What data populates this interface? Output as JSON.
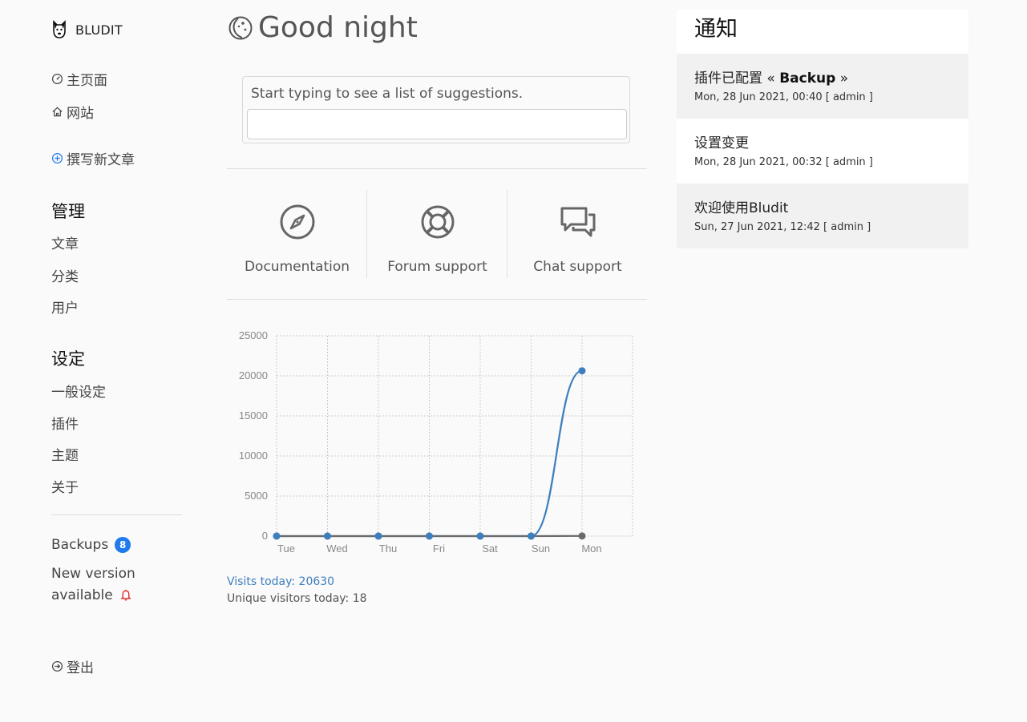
{
  "brand": {
    "name": "BLUDIT",
    "logo_icon": "dog-logo-icon"
  },
  "sidebar": {
    "top_links": [
      {
        "label": "主页面",
        "icon": "dashboard-icon"
      },
      {
        "label": "网站",
        "icon": "home-icon"
      }
    ],
    "new_content": {
      "label": "撰写新文章",
      "icon": "plus-circle-icon",
      "icon_color": "#1f7aec"
    },
    "manage": {
      "heading": "管理",
      "items": [
        {
          "label": "文章"
        },
        {
          "label": "分类"
        },
        {
          "label": "用户"
        }
      ]
    },
    "settings": {
      "heading": "设定",
      "items": [
        {
          "label": "一般设定"
        },
        {
          "label": "插件"
        },
        {
          "label": "主题"
        },
        {
          "label": "关于"
        }
      ]
    },
    "backups": {
      "label": "Backups",
      "count": "8"
    },
    "new_version": {
      "label": "New version available",
      "icon": "bell-icon",
      "icon_color": "#e02020"
    },
    "logout": {
      "label": "登出",
      "icon": "logout-icon"
    }
  },
  "main": {
    "greeting": {
      "text": "Good night",
      "icon": "moon-icon"
    },
    "search": {
      "hint": "Start typing to see a list of suggestions.",
      "value": ""
    },
    "support": [
      {
        "label": "Documentation",
        "icon": "compass-icon"
      },
      {
        "label": "Forum support",
        "icon": "life-ring-icon"
      },
      {
        "label": "Chat support",
        "icon": "chat-bubbles-icon"
      }
    ],
    "stats": {
      "visits_today": "Visits today: 20630",
      "unique_today": "Unique visitors today: 18"
    }
  },
  "chart_data": {
    "type": "line",
    "categories": [
      "Tue",
      "Wed",
      "Thu",
      "Fri",
      "Sat",
      "Sun",
      "Mon"
    ],
    "series": [
      {
        "values": [
          0,
          0,
          0,
          0,
          0,
          0,
          20630
        ],
        "color": "#3d7ebf"
      },
      {
        "values": [
          0,
          0,
          0,
          0,
          0,
          0,
          18
        ],
        "color": "#6b6b6b"
      }
    ],
    "yticks": [
      0,
      5000,
      10000,
      15000,
      20000,
      25000
    ],
    "ylim": [
      0,
      25000
    ],
    "grid": true
  },
  "notifications": {
    "title": "通知",
    "items": [
      {
        "prefix": "插件已配置 « ",
        "bold": "Backup",
        "suffix": " »",
        "time": "Mon, 28 Jun 2021, 00:40 [ admin ]"
      },
      {
        "prefix": "设置变更",
        "bold": "",
        "suffix": "",
        "time": "Mon, 28 Jun 2021, 00:32 [ admin ]"
      },
      {
        "prefix": "欢迎使用Bludit",
        "bold": "",
        "suffix": "",
        "time": "Sun, 27 Jun 2021, 12:42 [ admin ]"
      }
    ]
  }
}
